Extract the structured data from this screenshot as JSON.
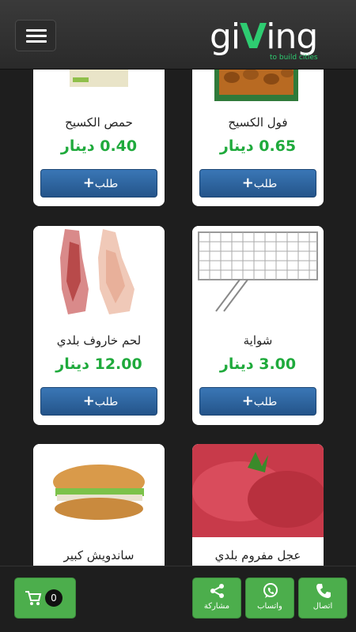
{
  "header": {
    "logo_text_left": "gi",
    "logo_text_v": "V",
    "logo_text_right": "ing",
    "logo_tagline": "to build cities"
  },
  "products": [
    {
      "name": "حمص الكسيح",
      "price": "0.40 دينار",
      "image": "chickpeas-can-image"
    },
    {
      "name": "فول الكسيح",
      "price": "0.65 دينار",
      "image": "fava-beans-can-image"
    },
    {
      "name": "لحم خاروف بلدي",
      "price": "12.00 دينار",
      "image": "lamb-carcass-image"
    },
    {
      "name": "شواية",
      "price": "3.00 دينار",
      "image": "grill-rack-image"
    },
    {
      "name": "ساندويش كبير",
      "price": "",
      "image": "sandwich-image"
    },
    {
      "name": "عجل مفروم بلدي",
      "price": "",
      "image": "minced-beef-image"
    }
  ],
  "order_label": "طلب",
  "cart": {
    "count": "0"
  },
  "actions": {
    "share": "مشاركة",
    "whatsapp": "واتساب",
    "call": "اتصال"
  },
  "colors": {
    "accent_green": "#2ecc71",
    "price_green": "#1faa3c",
    "button_blue": "#2c5f99",
    "action_green": "#4cae4c"
  }
}
